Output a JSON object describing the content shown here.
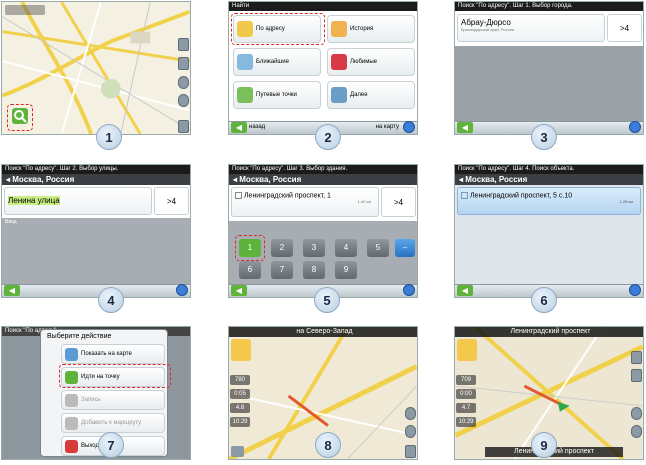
{
  "panel_numbers": [
    "1",
    "2",
    "3",
    "4",
    "5",
    "6",
    "7",
    "8",
    "9"
  ],
  "screen2": {
    "header": "Найти",
    "buttons": [
      {
        "label": "По адресу",
        "icon": "address-book-icon"
      },
      {
        "label": "История",
        "icon": "history-icon"
      },
      {
        "label": "Ближайшие",
        "icon": "nearby-icon"
      },
      {
        "label": "Любимые",
        "icon": "heart-icon"
      },
      {
        "label": "Путевые точки",
        "icon": "waypoint-flag-icon"
      },
      {
        "label": "Далее",
        "icon": "next-page-icon"
      }
    ],
    "back_label": "назад",
    "map_label": "на карту"
  },
  "screen3": {
    "title": "Поиск \"По адресу\". Шаг 1. Выбор города.",
    "result_main": "Абрау-Дюрсо",
    "result_sub": "Краснодарский край, Россия",
    "count": ">4"
  },
  "screen4": {
    "title": "Поиск \"По адресу\". Шаг 2. Выбор улицы.",
    "city": "Москва, Россия",
    "input": "Ленина улица",
    "count": ">4",
    "kb_label": "Ввод"
  },
  "screen5": {
    "title": "Поиск \"По адресу\". Шаг 3. Выбор здания.",
    "city": "Москва, Россия",
    "input": "Ленинградский проспект, 1",
    "distance": "1.40 км",
    "count": ">4",
    "keys": [
      "1",
      "2",
      "3",
      "4",
      "5",
      "6",
      "7",
      "8",
      "9"
    ]
  },
  "screen6": {
    "title": "Поиск \"По адресу\". Шаг 4. Поиск объекта.",
    "city": "Москва, Россия",
    "result": "Ленинградский проспект, 5 с.10",
    "distance": "1.28 км"
  },
  "screen7": {
    "title": "Поиск \"По адресу\". ...",
    "dialog_title": "Выберите действие",
    "actions": [
      {
        "label": "Показать на карте",
        "icon": "map-icon"
      },
      {
        "label": "Идти на точку",
        "icon": "walk-icon"
      },
      {
        "label": "Запись",
        "icon": "save-icon"
      },
      {
        "label": "Добавить к маршруту",
        "icon": "route-add-icon"
      },
      {
        "label": "Выход",
        "icon": "close-icon"
      }
    ]
  },
  "screen8": {
    "banner": "на Северо-Запад",
    "info": [
      "780",
      "0:05",
      "4.8",
      "10:29"
    ]
  },
  "screen9": {
    "banner": "Ленинградский проспект",
    "info": [
      "709",
      "0:00",
      "4.7",
      "10:29"
    ],
    "street_bottom": "Ленинградский проспект"
  },
  "colors": {
    "accent_green": "#5fb33a",
    "dash_red": "#e02a2a",
    "dark_bar": "#1b1b1b"
  }
}
